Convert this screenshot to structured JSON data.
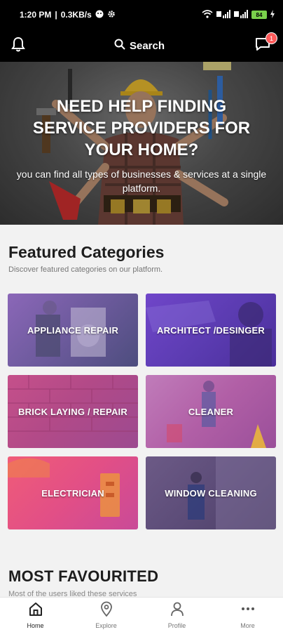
{
  "status_bar": {
    "time": "1:20 PM",
    "speed": "0.3KB/s",
    "battery": "84"
  },
  "header": {
    "search_label": "Search",
    "message_count": "1"
  },
  "hero": {
    "title": "NEED HELP FINDING SERVICE PROVIDERS FOR YOUR HOME?",
    "subtitle": "you can find all types of businesses & services at a single platform."
  },
  "featured": {
    "title": "Featured Categories",
    "subtitle": "Discover featured categories on our platform.",
    "categories": [
      {
        "label": "APPLIANCE REPAIR"
      },
      {
        "label": "ARCHITECT /DESINGER"
      },
      {
        "label": "BRICK LAYING / REPAIR"
      },
      {
        "label": "CLEANER"
      },
      {
        "label": "ELECTRICIAN"
      },
      {
        "label": "WINDOW CLEANING"
      }
    ]
  },
  "favourited": {
    "title": "MOST FAVOURITED",
    "subtitle": "Most of the users liked these services"
  },
  "nav": {
    "items": [
      {
        "label": "Home",
        "icon": "home-icon"
      },
      {
        "label": "Explore",
        "icon": "location-pin-icon"
      },
      {
        "label": "Profile",
        "icon": "user-icon"
      },
      {
        "label": "More",
        "icon": "more-dots-icon"
      }
    ]
  }
}
